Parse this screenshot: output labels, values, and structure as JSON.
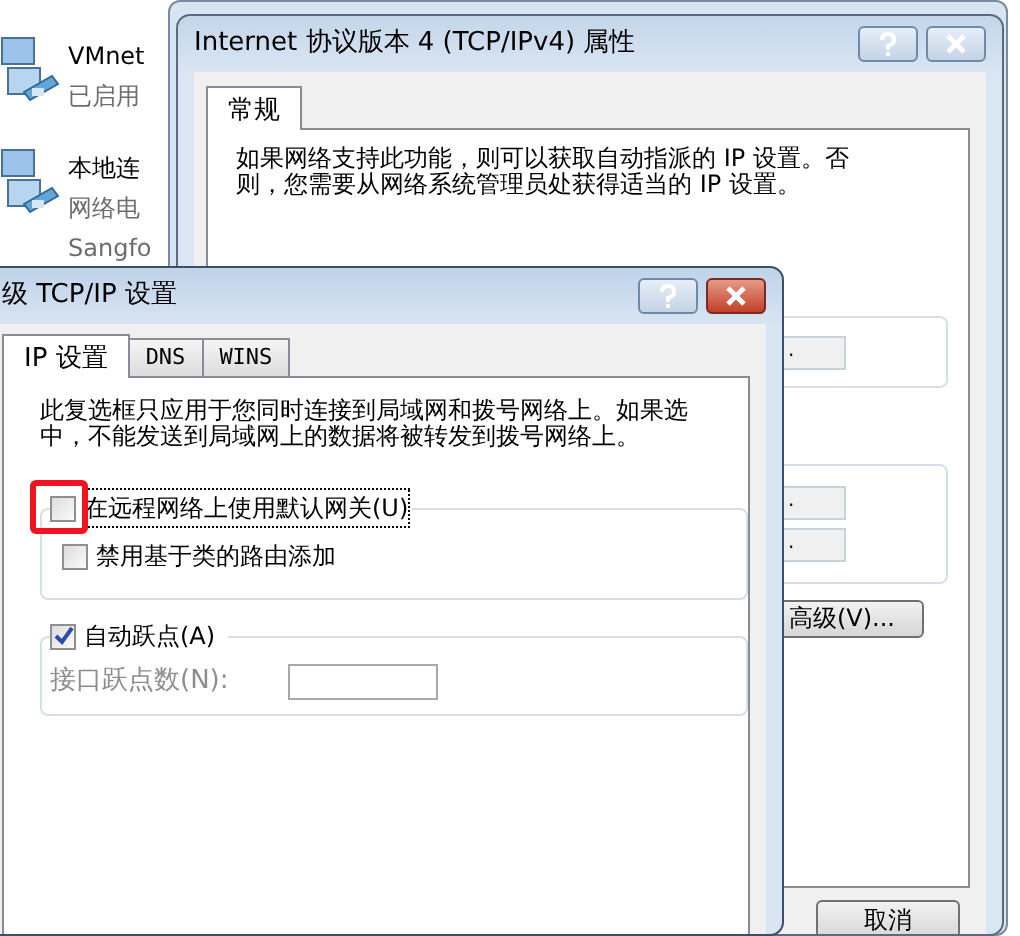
{
  "background_list": [
    {
      "name": "VMnet",
      "lines": [
        "已启用"
      ]
    },
    {
      "name": "本地连",
      "lines": [
        "网络电",
        "Sangfo"
      ]
    }
  ],
  "ipv4_dialog": {
    "title": "Internet 协议版本 4 (TCP/IPv4) 属性",
    "active": false,
    "tabs": [
      {
        "label": "常规",
        "selected": true
      }
    ],
    "description": "如果网络支持此功能，则可以获取自动指派的 IP 设置。否则，您需要从网络系统管理员处获得适当的 IP 设置。",
    "address_fields": [
      {
        "value": "."
      },
      {
        "value": "."
      },
      {
        "value": "."
      }
    ],
    "advanced_button": "高级(V)...",
    "cancel_button": "取消"
  },
  "advanced_dialog": {
    "title": "级 TCP/IP 设置",
    "active": true,
    "tabs": [
      {
        "label": "IP 设置",
        "selected": true
      },
      {
        "label": "DNS",
        "selected": false
      },
      {
        "label": "WINS",
        "selected": false
      }
    ],
    "description": "此复选框只应用于您同时连接到局域网和拨号网络上。如果选中，不能发送到局域网上的数据将被转发到拨号网络上。",
    "gateway_options": [
      {
        "label": "在远程网络上使用默认网关(U)",
        "checked": false,
        "focused": true,
        "highlighted": true
      },
      {
        "label": "禁用基于类的路由添加",
        "checked": false,
        "focused": false,
        "highlighted": false
      }
    ],
    "auto_metric": {
      "label": "自动跃点(A)",
      "checked": true
    },
    "metric_field": {
      "label": "接口跃点数(N):",
      "disabled": true
    }
  }
}
